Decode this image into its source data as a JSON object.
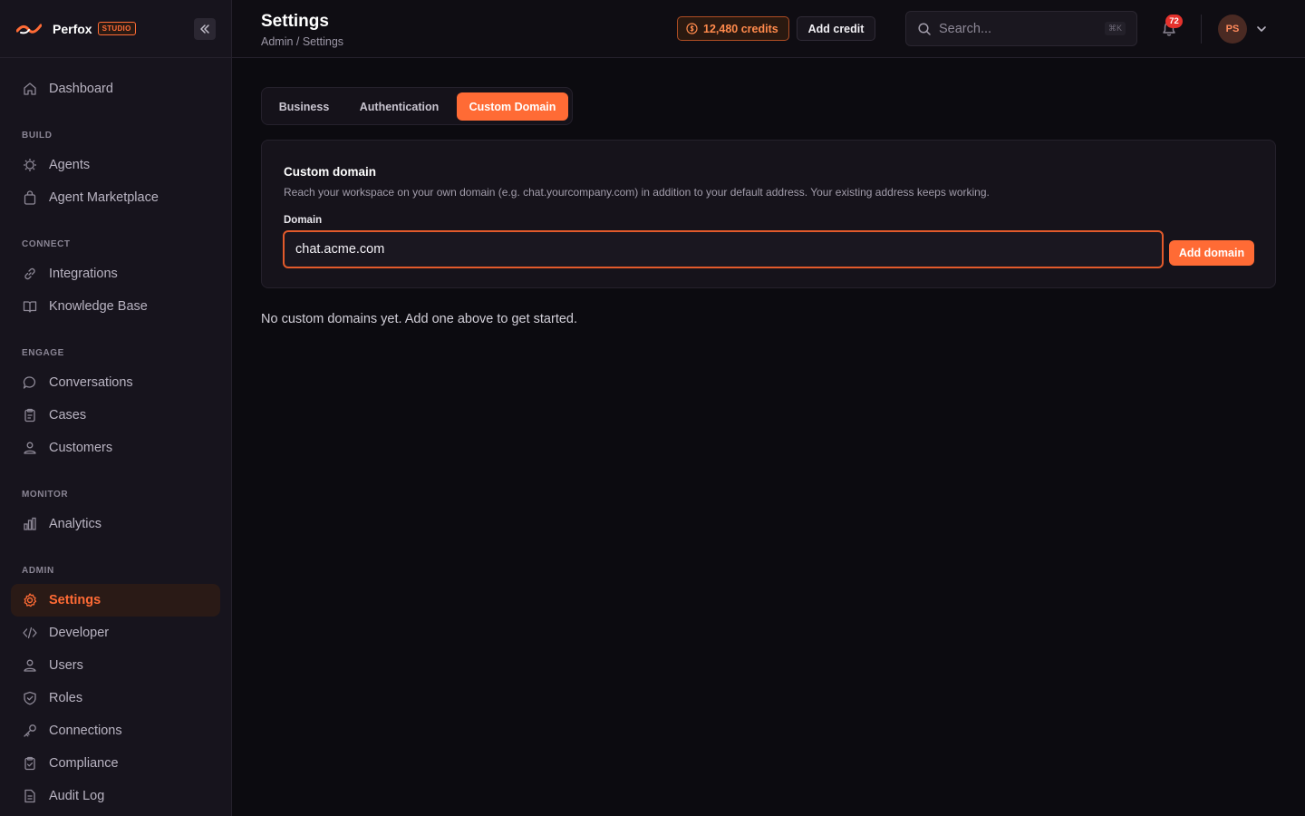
{
  "brand": {
    "name": "Perfox",
    "badge": "STUDIO"
  },
  "sidebar": {
    "items": [
      {
        "label": "Dashboard",
        "icon": "home-icon"
      },
      {
        "section": "BUILD"
      },
      {
        "label": "Agents",
        "icon": "agent-icon"
      },
      {
        "label": "Agent Marketplace",
        "icon": "bag-icon"
      },
      {
        "section": "CONNECT"
      },
      {
        "label": "Integrations",
        "icon": "link-icon"
      },
      {
        "label": "Knowledge Base",
        "icon": "book-icon"
      },
      {
        "section": "ENGAGE"
      },
      {
        "label": "Conversations",
        "icon": "chat-icon"
      },
      {
        "label": "Cases",
        "icon": "clipboard-icon"
      },
      {
        "label": "Customers",
        "icon": "customers-icon"
      },
      {
        "section": "MONITOR"
      },
      {
        "label": "Analytics",
        "icon": "chart-icon"
      },
      {
        "section": "ADMIN"
      },
      {
        "label": "Settings",
        "icon": "gear-icon",
        "active": true
      },
      {
        "label": "Developer",
        "icon": "code-icon"
      },
      {
        "label": "Users",
        "icon": "users-icon"
      },
      {
        "label": "Roles",
        "icon": "shield-icon"
      },
      {
        "label": "Connections",
        "icon": "key-icon"
      },
      {
        "label": "Compliance",
        "icon": "clipboard-check-icon"
      },
      {
        "label": "Audit Log",
        "icon": "document-icon"
      }
    ]
  },
  "header": {
    "title": "Settings",
    "breadcrumb": "Admin / Settings",
    "credits": "12,480 credits",
    "add_credit": "Add credit",
    "search_placeholder": "Search...",
    "search_shortcut": "⌘K",
    "notification_count": "72",
    "avatar_initials": "PS"
  },
  "tabs": [
    {
      "label": "Business",
      "active": false
    },
    {
      "label": "Authentication",
      "active": false
    },
    {
      "label": "Custom Domain",
      "active": true
    }
  ],
  "custom_domain": {
    "title": "Custom domain",
    "description": "Reach your workspace on your own domain (e.g. chat.yourcompany.com) in addition to your default address. Your existing address keeps working.",
    "field_label": "Domain",
    "input_value": "chat.acme.com",
    "button_label": "Add domain",
    "empty_state": "No custom domains yet. Add one above to get started."
  },
  "colors": {
    "accent": "#ff6b35",
    "background": "#0c0b10",
    "sidebar": "#17141d",
    "badge": "#e5322d"
  }
}
